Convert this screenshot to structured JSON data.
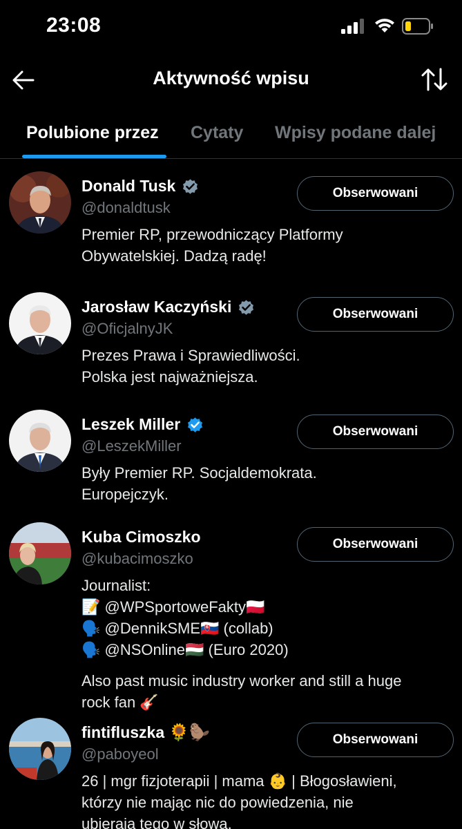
{
  "status_bar": {
    "time": "23:08",
    "icons": [
      "cellular-signal-icon",
      "wifi-icon",
      "battery-low-icon"
    ],
    "battery_color": "#ffd60a"
  },
  "header": {
    "title": "Aktywność wpisu",
    "back_icon": "arrow-left-icon",
    "sort_icon": "sort-arrows-icon"
  },
  "tabs": [
    {
      "label": "Polubione przez",
      "active": true
    },
    {
      "label": "Cytaty",
      "active": false
    },
    {
      "label": "Wpisy podane dalej",
      "active": false
    }
  ],
  "colors": {
    "accent": "#1d9bf0",
    "background": "#000000",
    "secondary_text": "#71767b"
  },
  "users": [
    {
      "name": "Donald Tusk",
      "verified": true,
      "handle": "@donaldtusk",
      "follow_label": "Obserwowani",
      "bio_lines": [
        "Premier RP, przewodniczący Platformy",
        "Obywatelskiej. Dadzą radę!"
      ]
    },
    {
      "name": "Jarosław Kaczyński",
      "verified": true,
      "handle": "@OficjalnyJK",
      "follow_label": "Obserwowani",
      "bio_lines": [
        "Prezes Prawa i Sprawiedliwości.",
        "Polska jest najważniejsza."
      ]
    },
    {
      "name": "Leszek Miller",
      "verified": true,
      "handle": "@LeszekMiller",
      "follow_label": "Obserwowani",
      "bio_lines": [
        "Były Premier RP. Socjaldemokrata.",
        "Europejczyk."
      ]
    },
    {
      "name": "Kuba Cimoszko",
      "verified": false,
      "handle": "@kubacimoszko",
      "follow_label": "Obserwowani",
      "bio_lines": [
        "Journalist:",
        "📝 @WPSportoweFakty🇵🇱",
        "🗣️ @DennikSME🇸🇰 (collab)",
        "🗣️ @NSOnline🇭🇺 (Euro 2020)"
      ],
      "bio_lines_2": [
        "Also past music industry worker and still a huge",
        "rock fan 🎸"
      ]
    },
    {
      "name": "fintifluszka",
      "name_emoji": "🌻🦫",
      "verified": false,
      "handle": "@paboyeol",
      "follow_label": "Obserwowani",
      "bio_lines": [
        "26 | mgr fizjoterapii | mama 👶 | Błogosławieni,",
        "którzy nie mając nic do powiedzenia, nie",
        "ubierają tego w słowa."
      ]
    }
  ]
}
